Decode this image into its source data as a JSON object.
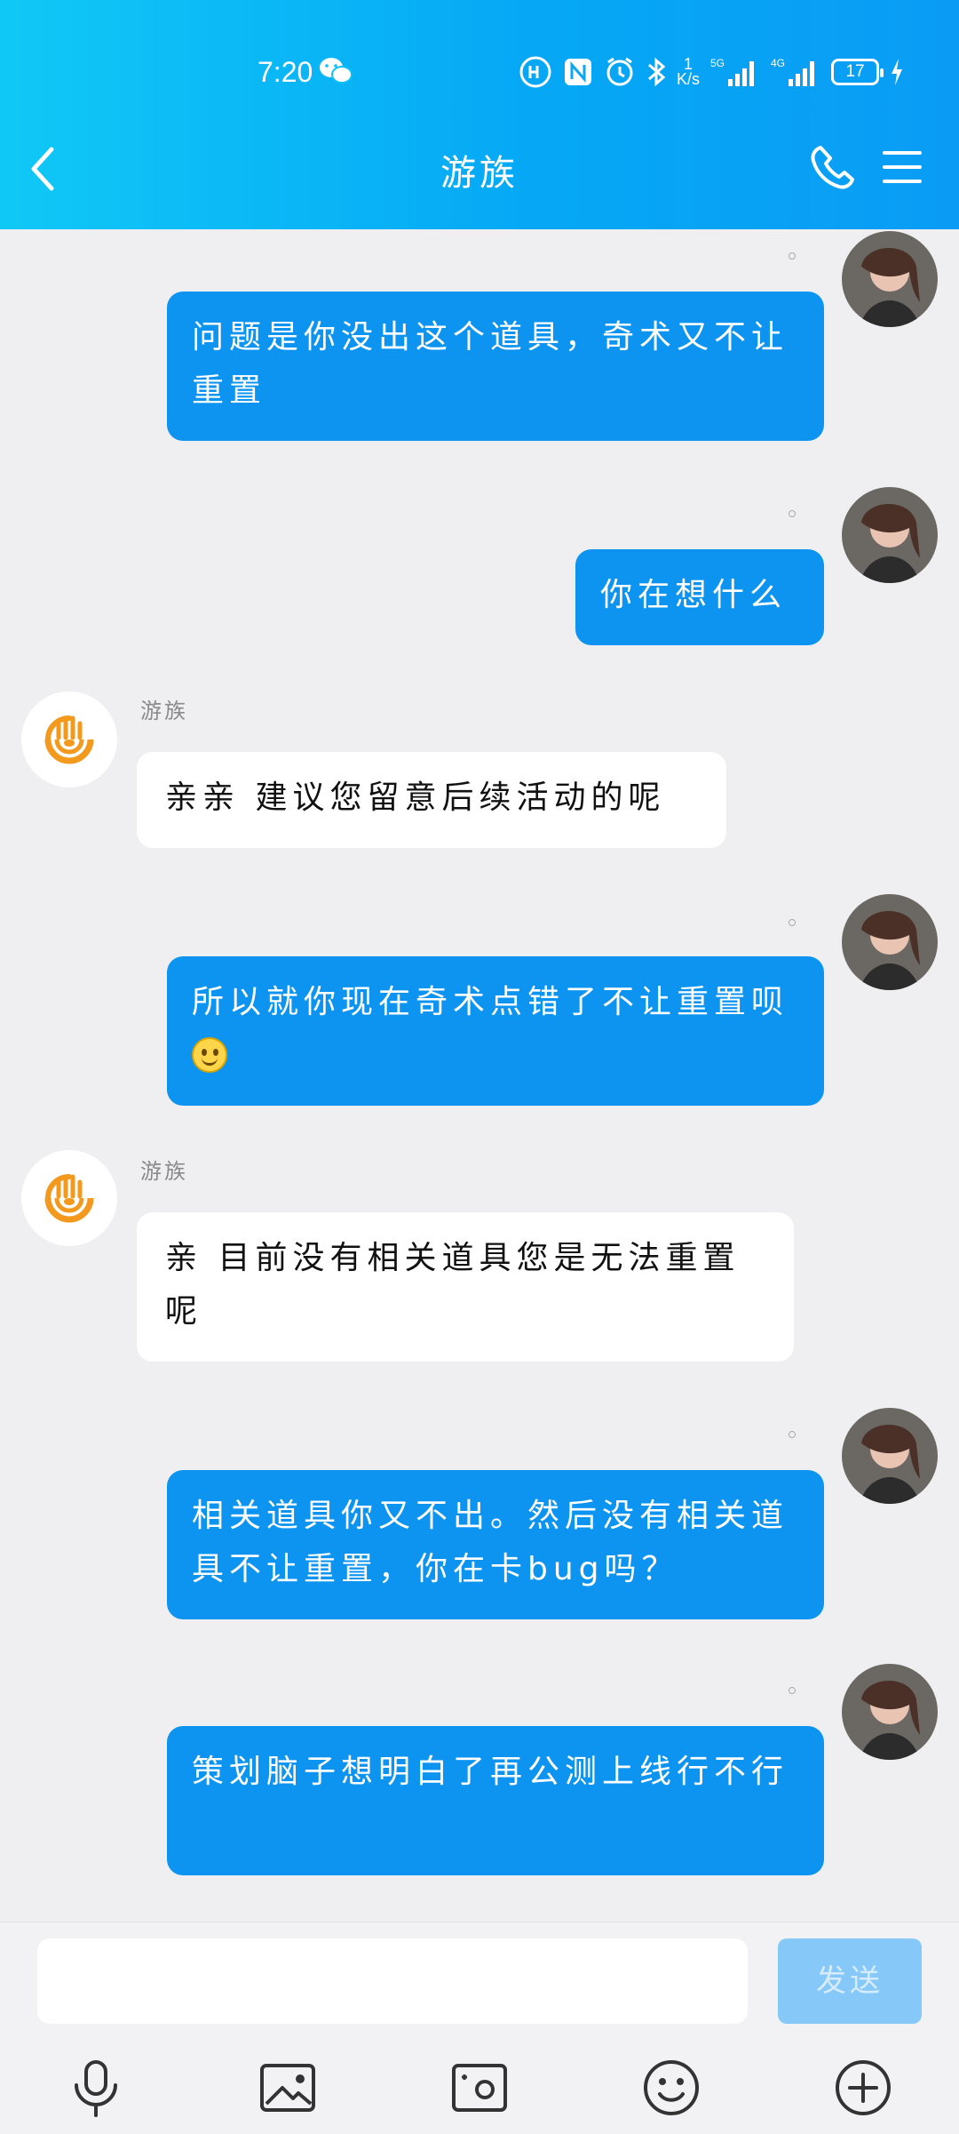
{
  "status_bar": {
    "time": "7:20",
    "net_speed_top": "1",
    "net_speed_unit": "K/s",
    "signal1": "5G",
    "signal2": "4G",
    "battery": "17"
  },
  "header": {
    "title": "游族"
  },
  "messages": [
    {
      "from": "me",
      "text": "问题是你没出这个道具，奇术又不让重置"
    },
    {
      "from": "me",
      "text": "你在想什么"
    },
    {
      "from": "service",
      "sender": "游族",
      "text": "亲亲 建议您留意后续活动的呢"
    },
    {
      "from": "me",
      "text": "所以就你现在奇术点错了不让重置呗"
    },
    {
      "from": "service",
      "sender": "游族",
      "text": "亲 目前没有相关道具您是无法重置呢"
    },
    {
      "from": "me",
      "text": "相关道具你又不出。然后没有相关道具不让重置，你在卡bug吗？"
    },
    {
      "from": "me",
      "text": "策划脑子想明白了再公测上线行不行"
    }
  ],
  "input": {
    "value": "",
    "send_label": "发送"
  },
  "toolbar_icons": [
    "microphone-icon",
    "image-icon",
    "camera-icon",
    "emoji-icon",
    "plus-icon"
  ],
  "colors": {
    "header": "#06a8f5",
    "outgoing_bubble": "#0c94f0",
    "background": "#efeff1"
  }
}
